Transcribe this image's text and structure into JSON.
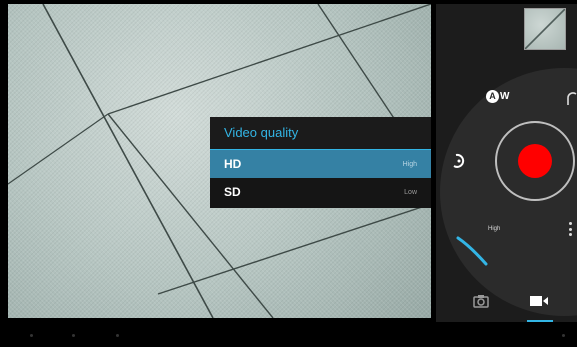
{
  "video_quality_popup": {
    "title": "Video quality",
    "options": [
      {
        "label": "HD",
        "sub": "High",
        "selected": true
      },
      {
        "label": "SD",
        "sub": "Low",
        "selected": false
      }
    ]
  },
  "camera_controls": {
    "white_balance_label": "W",
    "white_balance_badge": "A",
    "quality_indicator": "High",
    "modes": [
      "photo",
      "video"
    ],
    "active_mode": "video"
  },
  "colors": {
    "accent": "#33b5e5",
    "selected_row": "#3581a4",
    "record": "#ff0000",
    "panel": "#1c1c1c"
  },
  "icons": [
    "thumbnail",
    "white-balance-icon",
    "timer-icon",
    "record-button",
    "overflow-menu-icon",
    "camera-icon",
    "video-camera-icon"
  ]
}
